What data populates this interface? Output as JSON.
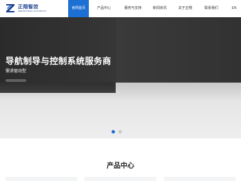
{
  "brand": {
    "name": "正翔智控",
    "subtitle": "ZHENGXIANG AUTOPILOT",
    "mark_letter": "Z",
    "primary_color": "#1c6fd3",
    "logo_color": "#1d3f8f"
  },
  "nav": {
    "items": [
      {
        "label": "官网首页",
        "active": true
      },
      {
        "label": "产品中心",
        "active": false
      },
      {
        "label": "服务与支持",
        "active": false
      },
      {
        "label": "新闻资讯",
        "active": false
      },
      {
        "label": "关于正翔",
        "active": false
      },
      {
        "label": "联系我们",
        "active": false
      }
    ],
    "language": "EN"
  },
  "hero": {
    "title": "导航制导与控制系统服务商",
    "subtitle": "需求驱动型",
    "slide_count": 2,
    "active_slide": 1
  },
  "products_section": {
    "title": "产品中心"
  }
}
